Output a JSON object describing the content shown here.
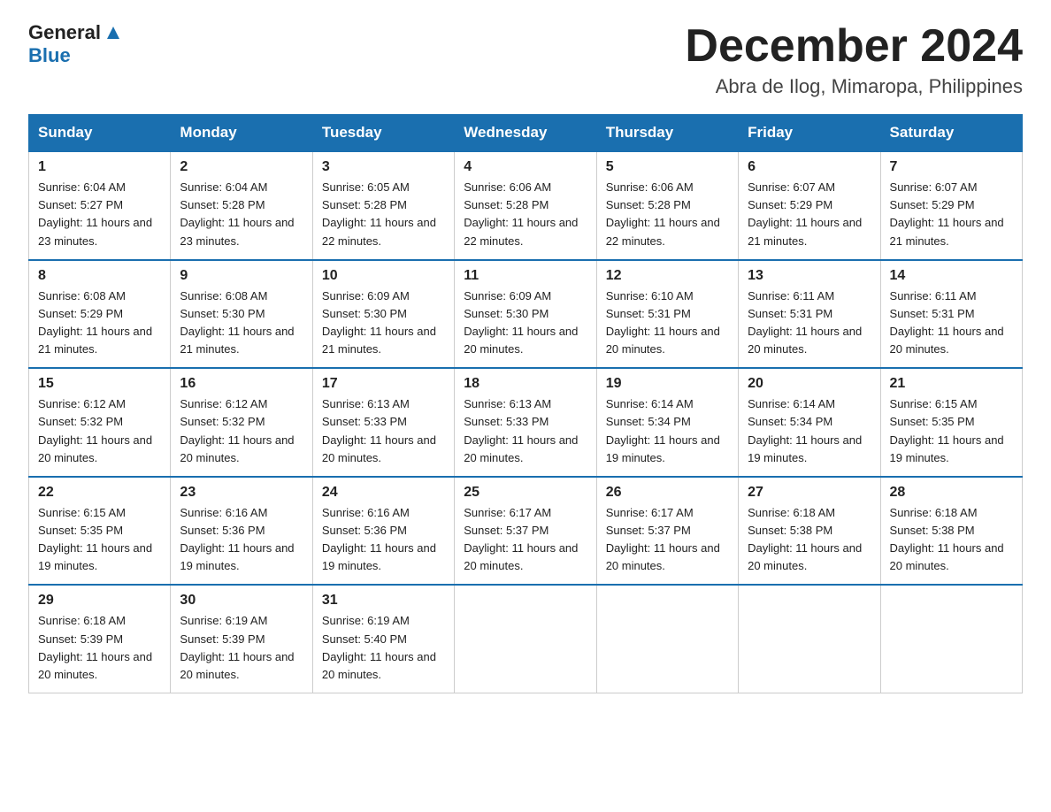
{
  "logo": {
    "text1": "General",
    "triangle": "▲",
    "text2": "Blue"
  },
  "title": "December 2024",
  "location": "Abra de Ilog, Mimaropa, Philippines",
  "days_of_week": [
    "Sunday",
    "Monday",
    "Tuesday",
    "Wednesday",
    "Thursday",
    "Friday",
    "Saturday"
  ],
  "weeks": [
    [
      {
        "day": "1",
        "sunrise": "6:04 AM",
        "sunset": "5:27 PM",
        "daylight": "11 hours and 23 minutes."
      },
      {
        "day": "2",
        "sunrise": "6:04 AM",
        "sunset": "5:28 PM",
        "daylight": "11 hours and 23 minutes."
      },
      {
        "day": "3",
        "sunrise": "6:05 AM",
        "sunset": "5:28 PM",
        "daylight": "11 hours and 22 minutes."
      },
      {
        "day": "4",
        "sunrise": "6:06 AM",
        "sunset": "5:28 PM",
        "daylight": "11 hours and 22 minutes."
      },
      {
        "day": "5",
        "sunrise": "6:06 AM",
        "sunset": "5:28 PM",
        "daylight": "11 hours and 22 minutes."
      },
      {
        "day": "6",
        "sunrise": "6:07 AM",
        "sunset": "5:29 PM",
        "daylight": "11 hours and 21 minutes."
      },
      {
        "day": "7",
        "sunrise": "6:07 AM",
        "sunset": "5:29 PM",
        "daylight": "11 hours and 21 minutes."
      }
    ],
    [
      {
        "day": "8",
        "sunrise": "6:08 AM",
        "sunset": "5:29 PM",
        "daylight": "11 hours and 21 minutes."
      },
      {
        "day": "9",
        "sunrise": "6:08 AM",
        "sunset": "5:30 PM",
        "daylight": "11 hours and 21 minutes."
      },
      {
        "day": "10",
        "sunrise": "6:09 AM",
        "sunset": "5:30 PM",
        "daylight": "11 hours and 21 minutes."
      },
      {
        "day": "11",
        "sunrise": "6:09 AM",
        "sunset": "5:30 PM",
        "daylight": "11 hours and 20 minutes."
      },
      {
        "day": "12",
        "sunrise": "6:10 AM",
        "sunset": "5:31 PM",
        "daylight": "11 hours and 20 minutes."
      },
      {
        "day": "13",
        "sunrise": "6:11 AM",
        "sunset": "5:31 PM",
        "daylight": "11 hours and 20 minutes."
      },
      {
        "day": "14",
        "sunrise": "6:11 AM",
        "sunset": "5:31 PM",
        "daylight": "11 hours and 20 minutes."
      }
    ],
    [
      {
        "day": "15",
        "sunrise": "6:12 AM",
        "sunset": "5:32 PM",
        "daylight": "11 hours and 20 minutes."
      },
      {
        "day": "16",
        "sunrise": "6:12 AM",
        "sunset": "5:32 PM",
        "daylight": "11 hours and 20 minutes."
      },
      {
        "day": "17",
        "sunrise": "6:13 AM",
        "sunset": "5:33 PM",
        "daylight": "11 hours and 20 minutes."
      },
      {
        "day": "18",
        "sunrise": "6:13 AM",
        "sunset": "5:33 PM",
        "daylight": "11 hours and 20 minutes."
      },
      {
        "day": "19",
        "sunrise": "6:14 AM",
        "sunset": "5:34 PM",
        "daylight": "11 hours and 19 minutes."
      },
      {
        "day": "20",
        "sunrise": "6:14 AM",
        "sunset": "5:34 PM",
        "daylight": "11 hours and 19 minutes."
      },
      {
        "day": "21",
        "sunrise": "6:15 AM",
        "sunset": "5:35 PM",
        "daylight": "11 hours and 19 minutes."
      }
    ],
    [
      {
        "day": "22",
        "sunrise": "6:15 AM",
        "sunset": "5:35 PM",
        "daylight": "11 hours and 19 minutes."
      },
      {
        "day": "23",
        "sunrise": "6:16 AM",
        "sunset": "5:36 PM",
        "daylight": "11 hours and 19 minutes."
      },
      {
        "day": "24",
        "sunrise": "6:16 AM",
        "sunset": "5:36 PM",
        "daylight": "11 hours and 19 minutes."
      },
      {
        "day": "25",
        "sunrise": "6:17 AM",
        "sunset": "5:37 PM",
        "daylight": "11 hours and 20 minutes."
      },
      {
        "day": "26",
        "sunrise": "6:17 AM",
        "sunset": "5:37 PM",
        "daylight": "11 hours and 20 minutes."
      },
      {
        "day": "27",
        "sunrise": "6:18 AM",
        "sunset": "5:38 PM",
        "daylight": "11 hours and 20 minutes."
      },
      {
        "day": "28",
        "sunrise": "6:18 AM",
        "sunset": "5:38 PM",
        "daylight": "11 hours and 20 minutes."
      }
    ],
    [
      {
        "day": "29",
        "sunrise": "6:18 AM",
        "sunset": "5:39 PM",
        "daylight": "11 hours and 20 minutes."
      },
      {
        "day": "30",
        "sunrise": "6:19 AM",
        "sunset": "5:39 PM",
        "daylight": "11 hours and 20 minutes."
      },
      {
        "day": "31",
        "sunrise": "6:19 AM",
        "sunset": "5:40 PM",
        "daylight": "11 hours and 20 minutes."
      },
      null,
      null,
      null,
      null
    ]
  ],
  "labels": {
    "sunrise": "Sunrise:",
    "sunset": "Sunset:",
    "daylight": "Daylight:"
  }
}
